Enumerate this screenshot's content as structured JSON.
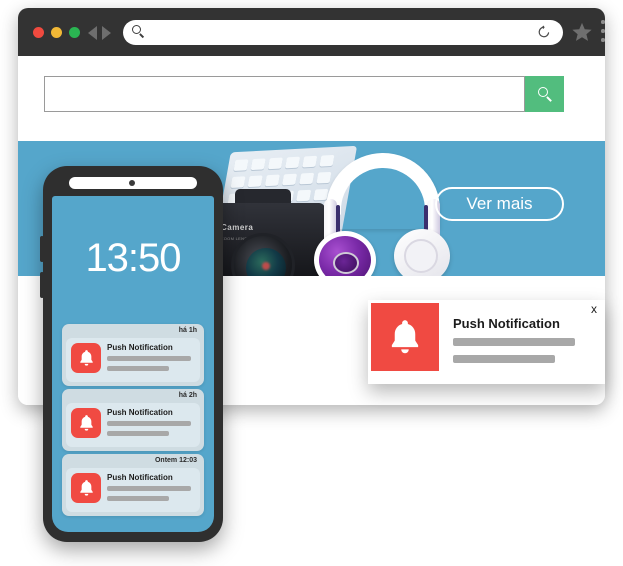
{
  "browser": {
    "traffic_lights": [
      "close",
      "minimize",
      "maximize"
    ],
    "nav": {
      "back": "back",
      "forward": "forward"
    },
    "address_bar": {
      "value": "",
      "placeholder": "",
      "search_icon": "search-icon",
      "reload_icon": "reload-icon"
    },
    "bookmark_icon": "star-icon",
    "overflow_icon": "three-dots-vertical-icon"
  },
  "site": {
    "search": {
      "value": "",
      "placeholder": "",
      "button_icon": "search-icon",
      "button_color": "#52bd7e"
    },
    "hero": {
      "background_color": "#55a6cb",
      "cta_label": "Ver mais",
      "products": [
        "keyboard",
        "camera",
        "headphones"
      ],
      "camera_brand": "Camera",
      "camera_lens_text": "ZOOM LENS 28-80MM"
    }
  },
  "phone": {
    "clock": "13:50",
    "screen_color": "#55a6cb",
    "notifications": [
      {
        "time": "há 1h",
        "title": "Push Notification",
        "icon": "bell-icon",
        "icon_color": "#f04a42"
      },
      {
        "time": "há 2h",
        "title": "Push Notification",
        "icon": "bell-icon",
        "icon_color": "#f04a42"
      },
      {
        "time": "Ontem 12:03",
        "title": "Push Notification",
        "icon": "bell-icon",
        "icon_color": "#f04a42"
      }
    ]
  },
  "popup": {
    "title": "Push Notification",
    "icon": "bell-icon",
    "icon_color": "#f04a42",
    "close_label": "x"
  }
}
